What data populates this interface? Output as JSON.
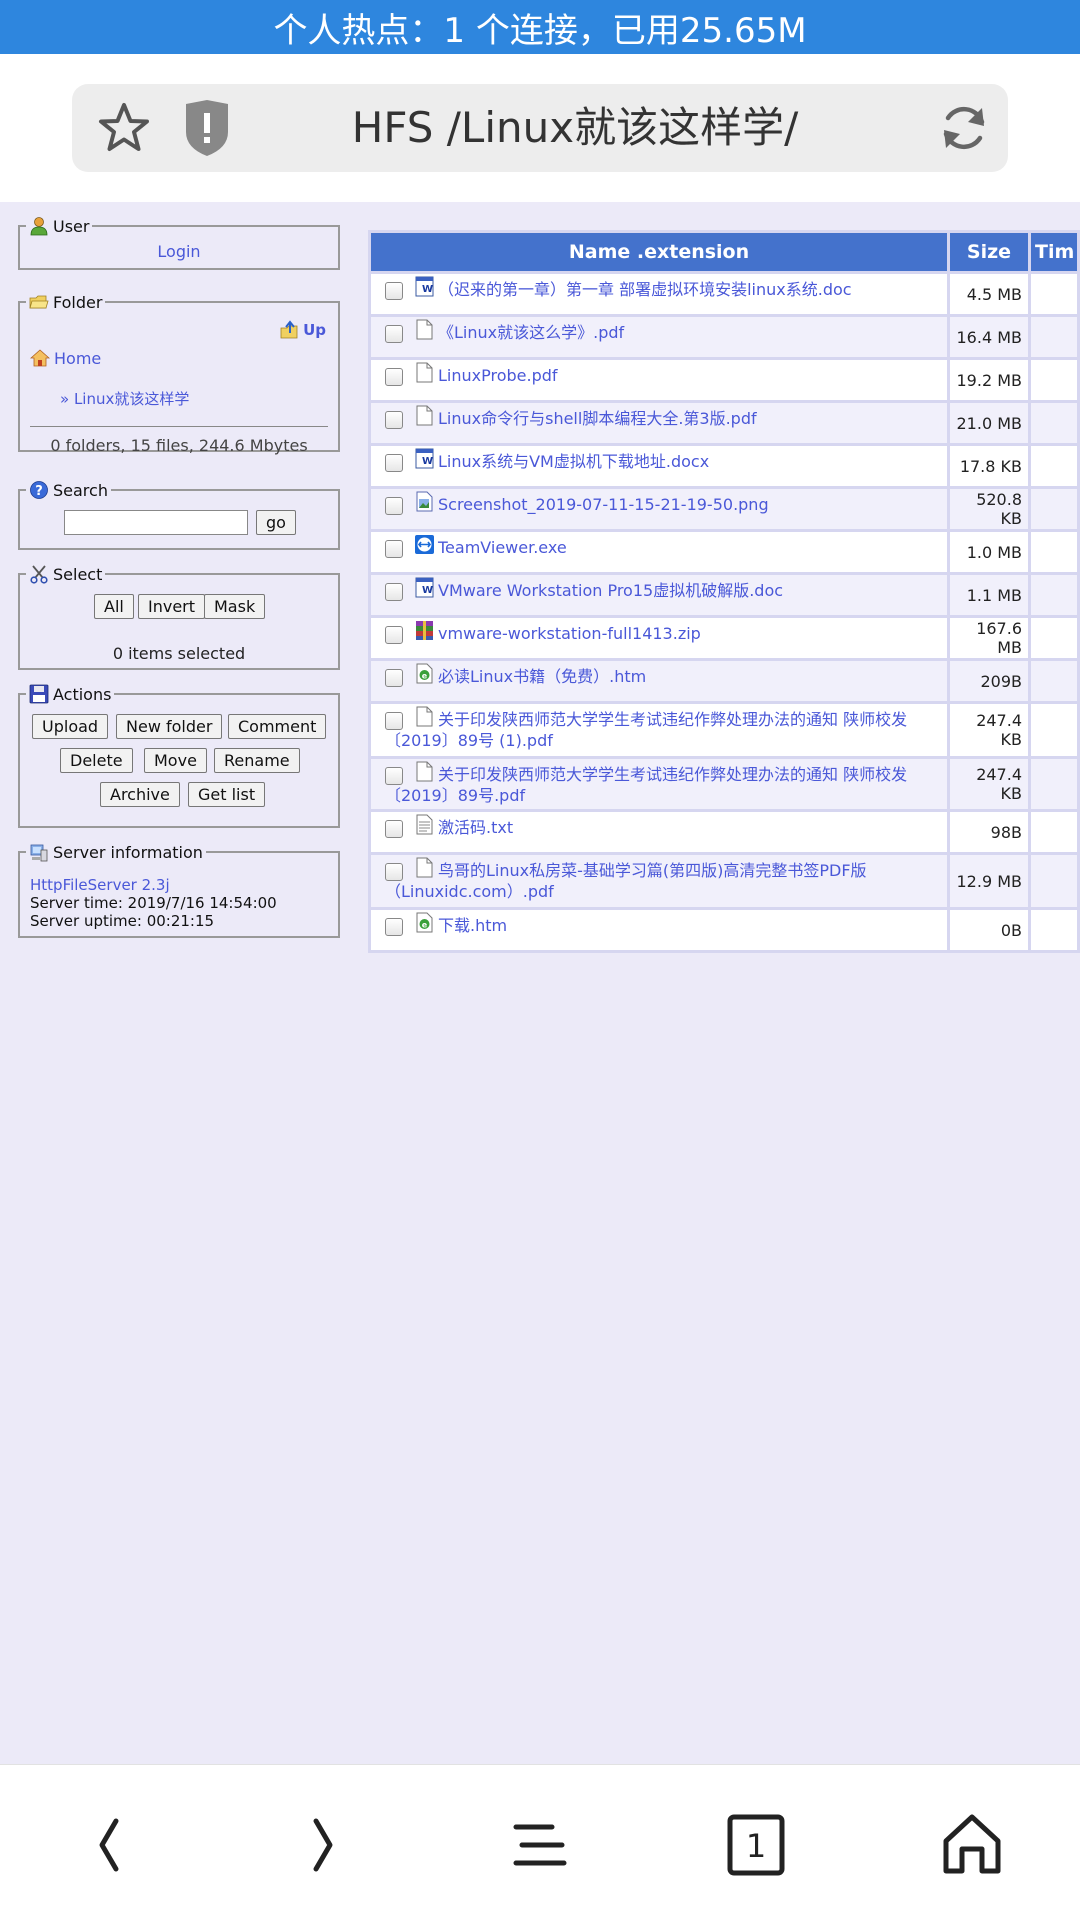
{
  "status_bar": {
    "text": "个人热点：1 个连接，已用25.65M"
  },
  "browser": {
    "title": "HFS /Linux就该这样学/"
  },
  "user_panel": {
    "legend": "User",
    "login": "Login"
  },
  "folder_panel": {
    "legend": "Folder",
    "up": "Up",
    "home": "Home",
    "current": "» Linux就该这样学",
    "stats": "0 folders, 15 files, 244.6 Mbytes"
  },
  "search_panel": {
    "legend": "Search",
    "placeholder": "",
    "go": "go"
  },
  "select_panel": {
    "legend": "Select",
    "all": "All",
    "invert": "Invert",
    "mask": "Mask",
    "selected": "0 items selected"
  },
  "actions_panel": {
    "legend": "Actions",
    "upload": "Upload",
    "new_folder": "New folder",
    "comment": "Comment",
    "delete": "Delete",
    "move": "Move",
    "rename": "Rename",
    "archive": "Archive",
    "get_list": "Get list"
  },
  "server_panel": {
    "legend": "Server information",
    "software": "HttpFileServer 2.3j",
    "time": "Server time: 2019/7/16 14:54:00",
    "uptime": "Server uptime: 00:21:15"
  },
  "table": {
    "headers": {
      "name": "Name .extension",
      "size": "Size",
      "time": "Tim"
    },
    "files": [
      {
        "name": "（迟来的第一章）第一章 部署虚拟环境安装linux系统.doc",
        "size": "4.5 MB",
        "icon": "word-doc-icon"
      },
      {
        "name": "《Linux就该这么学》.pdf",
        "size": "16.4 MB",
        "icon": "blank-file-icon"
      },
      {
        "name": "LinuxProbe.pdf",
        "size": "19.2 MB",
        "icon": "blank-file-icon"
      },
      {
        "name": "Linux命令行与shell脚本编程大全.第3版.pdf",
        "size": "21.0 MB",
        "icon": "blank-file-icon"
      },
      {
        "name": "Linux系统与VM虚拟机下载地址.docx",
        "size": "17.8 KB",
        "icon": "word-doc-icon"
      },
      {
        "name": "Screenshot_2019-07-11-15-21-19-50.png",
        "size": "520.8 KB",
        "icon": "image-file-icon"
      },
      {
        "name": "TeamViewer.exe",
        "size": "1.0 MB",
        "icon": "teamviewer-icon"
      },
      {
        "name": "VMware Workstation Pro15虚拟机破解版.doc",
        "size": "1.1 MB",
        "icon": "word-doc-icon"
      },
      {
        "name": "vmware-workstation-full1413.zip",
        "size": "167.6 MB",
        "icon": "archive-icon"
      },
      {
        "name": "必读Linux书籍（免费）.htm",
        "size": "209B",
        "icon": "html-file-icon"
      },
      {
        "name": "关于印发陕西师范大学学生考试违纪作弊处理办法的通知 陕师校发〔2019〕89号 (1).pdf",
        "size": "247.4 KB",
        "icon": "blank-file-icon"
      },
      {
        "name": "关于印发陕西师范大学学生考试违纪作弊处理办法的通知 陕师校发〔2019〕89号.pdf",
        "size": "247.4 KB",
        "icon": "blank-file-icon"
      },
      {
        "name": "激活码.txt",
        "size": "98B",
        "icon": "text-file-icon"
      },
      {
        "name": "鸟哥的Linux私房菜-基础学习篇(第四版)高清完整书签PDF版（Linuxidc.com）.pdf",
        "size": "12.9 MB",
        "icon": "blank-file-icon"
      },
      {
        "name": "下载.htm",
        "size": "0B",
        "icon": "html-file-icon"
      }
    ]
  },
  "bottom_nav": {
    "tabs_count": "1"
  },
  "colors": {
    "accent": "#2e86de",
    "header": "#4472cc",
    "link": "#4a58d8",
    "page_bg": "#eceaf8"
  }
}
